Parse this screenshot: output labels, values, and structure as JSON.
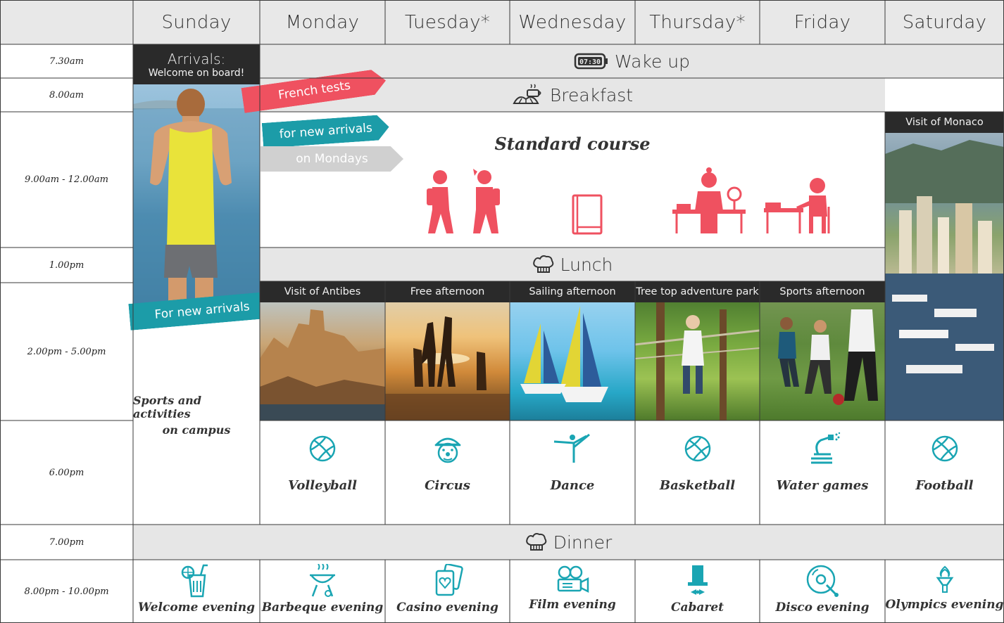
{
  "header": {
    "days": [
      "Sunday",
      "Monday",
      "Tuesday*",
      "Wednesday",
      "Thursday*",
      "Friday",
      "Saturday"
    ]
  },
  "times": [
    "7.30am",
    "8.00am",
    "9.00am - 12.00am",
    "1.00pm",
    "2.00pm - 5.00pm",
    "6.00pm",
    "7.00pm",
    "8.00pm - 10.00pm"
  ],
  "sunday": {
    "arrivals_title": "Arrivals:",
    "arrivals_sub": "Welcome on board!",
    "sports_line1": "Sports and activities",
    "sports_line2": "on campus",
    "for_new_arrivals": "For new arrivals"
  },
  "ribbons": {
    "french_tests": "French tests",
    "for_new_arrivals": "for new arrivals",
    "on_mondays": "on Mondays"
  },
  "bands": {
    "wake_up": "Wake up",
    "breakfast": "Breakfast",
    "lunch": "Lunch",
    "dinner": "Dinner"
  },
  "course": {
    "title": "Standard course"
  },
  "afternoons": [
    "Visit of Antibes",
    "Free afternoon",
    "Sailing afternoon",
    "Tree top adventure park",
    "Sports afternoon"
  ],
  "saturday": {
    "visit": "Visit of Monaco"
  },
  "activities": [
    "Volleyball",
    "Circus",
    "Dance",
    "Basketball",
    "Water games",
    "Football"
  ],
  "evenings": [
    "Welcome evening",
    "Barbeque evening",
    "Casino evening",
    "Film evening",
    "Cabaret",
    "Disco evening",
    "Olympics evening"
  ],
  "colors": {
    "band_grey": "#e6e6e6",
    "red": "#ef5160",
    "teal": "#1c9ca8",
    "icon_teal": "#1aa5b3",
    "caption_dark": "#2a2a2a"
  }
}
